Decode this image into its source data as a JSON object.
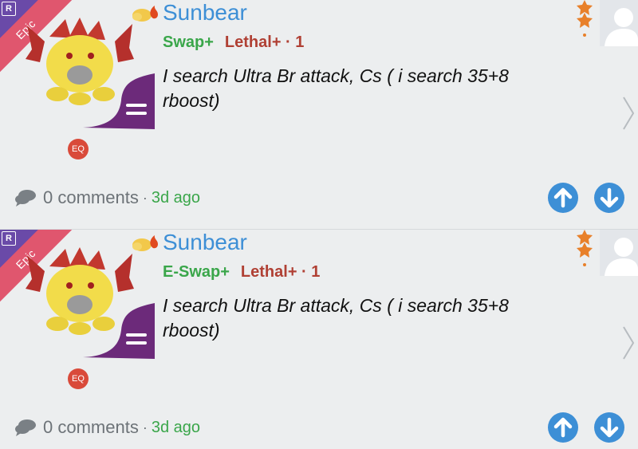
{
  "posts": [
    {
      "rarity_tag": "R",
      "rarity_label": "Epic",
      "username": "Sunbear",
      "tags": {
        "swap": "Swap+",
        "lethal": "Lethal+ · 1"
      },
      "message": "I search Ultra Br attack, Cs ( i search 35+8 rboost)",
      "eq_badge": "EQ",
      "comments": "0 comments",
      "separator": "·",
      "time_ago": "3d ago"
    },
    {
      "rarity_tag": "R",
      "rarity_label": "Epic",
      "username": "Sunbear",
      "tags": {
        "swap": "E-Swap+",
        "lethal": "Lethal+ · 1"
      },
      "message": "I search Ultra Br attack, Cs ( i search 35+8 rboost)",
      "eq_badge": "EQ",
      "comments": "0 comments",
      "separator": "·",
      "time_ago": "3d ago"
    }
  ],
  "colors": {
    "accent_blue": "#3d8fd6",
    "green": "#3aa64a",
    "red": "#b04034",
    "epic_pink": "#e0566e",
    "eq_red": "#d94a3a"
  },
  "icons": {
    "comment": "speech-bubble-icon",
    "up": "arrow-up-icon",
    "down": "arrow-down-icon",
    "next": "chevron-right-icon",
    "rank": "star-icon"
  }
}
